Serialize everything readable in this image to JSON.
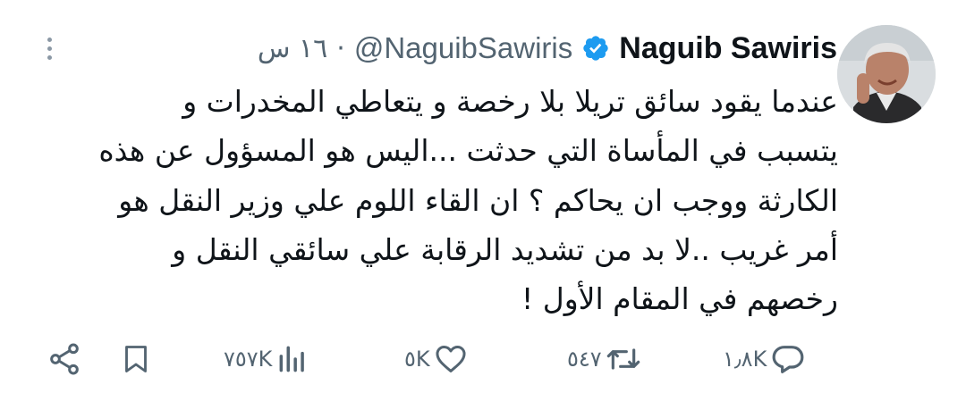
{
  "tweet": {
    "author_name": "Naguib Sawiris",
    "handle": "@NaguibSawiris",
    "separator": "·",
    "time": "١٦ س",
    "verified": true,
    "lines": [
      "عندما يقود سائق تريلا بلا رخصة و يتعاطي المخدرات و",
      "يتسبب في المأساة التي حدثت ...اليس هو المسؤول عن هذه",
      "الكارثة ووجب ان يحاكم ؟  ان القاء اللوم علي وزير النقل هو",
      "أمر غريب ..لا بد من تشديد الرقابة علي سائقي النقل و",
      "رخصهم في المقام الأول !"
    ]
  },
  "actions": {
    "replies": "١٫٨K",
    "retweets": "٥٤٧",
    "likes": "٥K",
    "views": "٧٥٧K"
  },
  "icons": {
    "more": "more-vertical-icon",
    "verified": "verified-badge-icon",
    "reply": "reply-icon",
    "retweet": "retweet-icon",
    "like": "heart-icon",
    "views": "views-icon",
    "bookmark": "bookmark-icon",
    "share": "share-icon"
  },
  "colors": {
    "text": "#0f1419",
    "muted": "#536471",
    "verified": "#1d9bf0",
    "background": "#ffffff"
  }
}
